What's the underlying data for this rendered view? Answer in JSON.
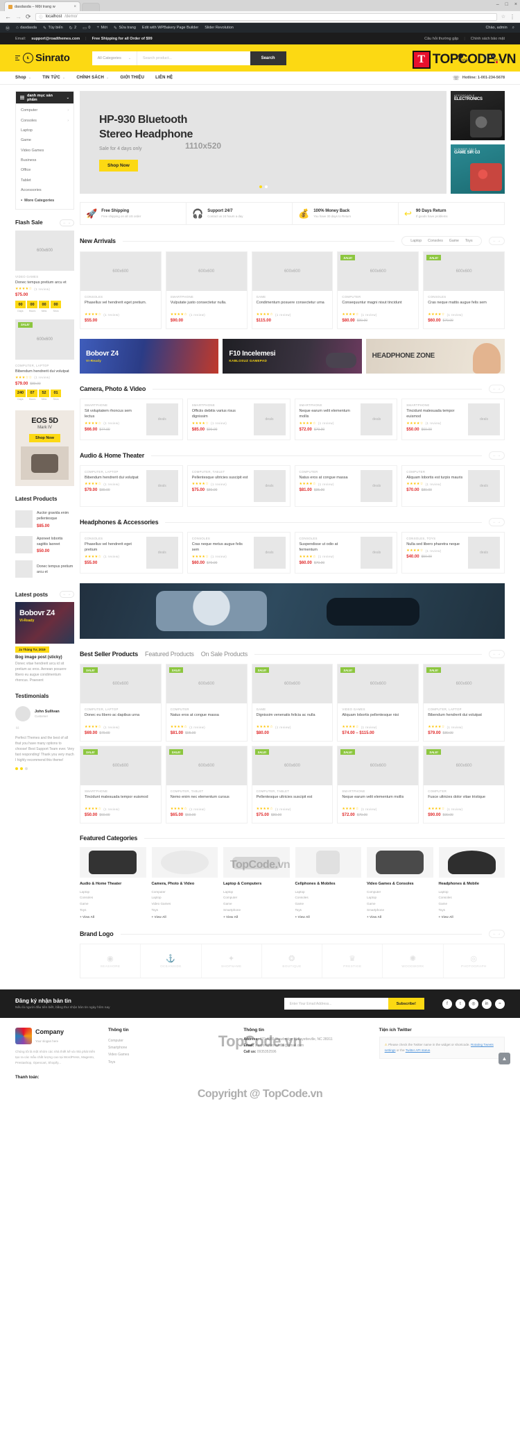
{
  "browser": {
    "tab_title": "dasdasda – Một trang w",
    "url_host": "localhost",
    "url_path": "/demo/",
    "lock_icon": "info-icon",
    "back_icon": "←",
    "forward_icon": "→",
    "reload_icon": "⟳",
    "star_icon": "☆",
    "menu_icon": "⋮",
    "minimize": "–",
    "maximize": "□",
    "close": "×"
  },
  "adminbar": {
    "wp_logo": "Ⓦ",
    "items": [
      {
        "icon": "home-icon",
        "label": "dasdasda"
      },
      {
        "icon": "pencil-icon",
        "label": "Tùy biến"
      },
      {
        "icon": "comment-icon",
        "label": "2"
      },
      {
        "icon": "speech-icon",
        "label": "0"
      },
      {
        "icon": "plus-icon",
        "label": "Mới"
      },
      {
        "icon": "edit-icon",
        "label": "Sửa trang"
      },
      {
        "icon": "",
        "label": "Edit with WPBakery Page Builder"
      },
      {
        "icon": "",
        "label": "Slider Revolution"
      }
    ],
    "right": [
      {
        "icon": "",
        "label": "Chào, admin"
      },
      {
        "icon": "search-icon",
        "label": ""
      }
    ]
  },
  "watermark": {
    "badge": "T",
    "text_a": "TOPCODE",
    "text_dot": ".",
    "text_b": "VN",
    "center_1": "TopCode.vn",
    "center_2": "TopCode.vn",
    "center_3": "Copyright @ TopCode.vn"
  },
  "topbar": {
    "email_label": "Email:",
    "email": "support@roadthemes.com",
    "shipping": "Free Shipping for all Order of $99",
    "link_faq": "Câu hỏi thường gặp",
    "link_privacy": "Chính sách bảo mật",
    "separator": "|"
  },
  "header": {
    "brand": "Sinrato",
    "search_category": "All Categories",
    "search_placeholder": "Search product...",
    "search_button": "Search",
    "wishlist_label": "Wishlist",
    "wishlist_count": "0",
    "cart_label": "My cart",
    "cart_count": "0",
    "heart_icon": "♡",
    "cart_icon": "🛒"
  },
  "mainnav": {
    "items": [
      {
        "label": "Shop",
        "caret": "⌄"
      },
      {
        "label": "TIN TỨC",
        "caret": "⌄"
      },
      {
        "label": "CHÍNH SÁCH",
        "caret": "⌄"
      },
      {
        "label": "GIỚI THIỆU",
        "caret": ""
      },
      {
        "label": "LIÊN HỆ",
        "caret": ""
      }
    ],
    "hotline": "Hotline: 1-001-234-5678",
    "hotline_icon": "headset-icon"
  },
  "sidebar": {
    "category_title": "danh mục sản phẩm",
    "categories": [
      {
        "label": "Computer",
        "arrow": "›"
      },
      {
        "label": "Consoles",
        "arrow": "›"
      },
      {
        "label": "Laptop",
        "arrow": ""
      },
      {
        "label": "Game",
        "arrow": ""
      },
      {
        "label": "Video Games",
        "arrow": ""
      },
      {
        "label": "Business",
        "arrow": ""
      },
      {
        "label": "Office",
        "arrow": ""
      },
      {
        "label": "Tablet",
        "arrow": ""
      },
      {
        "label": "Accessories",
        "arrow": ""
      }
    ],
    "more_categories": "More Categories",
    "flash_sale": {
      "title": "Flash Sale",
      "products": [
        {
          "placeholder": "600x600",
          "category": "VIDEO GAMES",
          "title": "Donec tempus pretium arcu et",
          "rating": "★★★★☆",
          "reviews": "(1 review)",
          "price": "$75.00",
          "old_price": "",
          "sale_badge": "",
          "countdown": [
            {
              "num": "00",
              "label": "Days"
            },
            {
              "num": "00",
              "label": "Hours"
            },
            {
              "num": "00",
              "label": "Mins"
            },
            {
              "num": "00",
              "label": "Secs"
            }
          ]
        },
        {
          "placeholder": "600x600",
          "category": "COMPUTER, LAPTOP",
          "title": "Bibendum hendrerit dui volutpat",
          "rating": "★★★☆☆",
          "reviews": "(1 review)",
          "price": "$79.00",
          "old_price": "$89.00",
          "sale_badge": "SALE!",
          "countdown": [
            {
              "num": "240",
              "label": "Days"
            },
            {
              "num": "07",
              "label": "Hours"
            },
            {
              "num": "52",
              "label": "Mins"
            },
            {
              "num": "01",
              "label": "Secs"
            }
          ]
        }
      ]
    },
    "promo": {
      "title": "EOS 5D",
      "subtitle": "Mark IV",
      "button": "Shop Now"
    },
    "latest_products": {
      "title": "Latest Products",
      "items": [
        {
          "thumb": "",
          "category": "",
          "title": "Auctor gravida enim pellentesque",
          "price": "$85.00"
        },
        {
          "thumb": "",
          "category": "",
          "title": "Aponeet lobortis sagittis laoreet",
          "price": "$50.00"
        },
        {
          "thumb": "",
          "category": "",
          "title": "Donec tempus pretium arcu et",
          "price": ""
        }
      ]
    },
    "latest_posts": {
      "title": "Latest posts",
      "post": {
        "overlay_title": "Bobovr Z4",
        "overlay_sub": "VI-Ready",
        "date": "Ja Tháng Tư, 2019",
        "title": "Bog image post (sticky)",
        "excerpt": "Donec vitae hendrerit arcu id sit pretium ac eros. Aenean posuere libero eu augue condimentum rhoncus. Praesent"
      }
    },
    "testimonials": {
      "title": "Testimonials",
      "name": "John Sullivan",
      "role": "Customer",
      "quote_mark": "❝",
      "body": "Perfect Themes and the best of all that you have many options to choose! Best Support Team ever. Very fast responding! Thank you very much I highly recommend this theme!",
      "dots": 3
    }
  },
  "hero": {
    "title_line1": "HP-930 Bluetooth",
    "title_line2": "Stereo Headphone",
    "subtitle": "Sale for 4 days only",
    "dimension": "1110x520",
    "button": "Shop Now",
    "dots": 2,
    "side_banners": [
      {
        "kicker": "AFFORDABLE",
        "title": "ELECTRONICS"
      },
      {
        "kicker": "SUMMER SALE",
        "title": "GAME SIR G3"
      }
    ]
  },
  "services": [
    {
      "icon": "rocket-icon",
      "title": "Free Shipping",
      "desc": "Free shipping on all US order"
    },
    {
      "icon": "headset-icon",
      "title": "Support 24/7",
      "desc": "Contact us 24 hours a day"
    },
    {
      "icon": "money-icon",
      "title": "100% Money Back",
      "desc": "You have 30 days to Return"
    },
    {
      "icon": "return-icon",
      "title": "90 Days Return",
      "desc": "If goods have problems"
    }
  ],
  "sections": {
    "new_arrivals": {
      "title": "New Arrivals",
      "tabs": [
        "Laptop",
        "Consoles",
        "Game",
        "Toys"
      ],
      "products": [
        {
          "placeholder": "600x600",
          "sale_badge": "",
          "category": "CONSOLES",
          "title": "Phasellus vel hendrerit eget pretium.",
          "rating": "★★★★☆",
          "reviews": "(1 review)",
          "price": "$55.00",
          "old_price": ""
        },
        {
          "placeholder": "600x600",
          "sale_badge": "",
          "category": "SMARTPHONE",
          "title": "Vulputate justo consectetur nulla.",
          "rating": "★★★★☆",
          "reviews": "(1 review)",
          "price": "$90.00",
          "old_price": ""
        },
        {
          "placeholder": "600x600",
          "sale_badge": "",
          "category": "GAME",
          "title": "Condimentum posuere consectetur urna",
          "rating": "★★★★☆",
          "reviews": "(1 review)",
          "price": "$115.00",
          "old_price": ""
        },
        {
          "placeholder": "600x600",
          "sale_badge": "SALE!",
          "category": "COMPUTER",
          "title": "Consequuntur magni nisut tincidunt",
          "rating": "★★★★☆",
          "reviews": "(1 review)",
          "price": "$80.00",
          "old_price": "$90.00"
        },
        {
          "placeholder": "600x600",
          "sale_badge": "SALE!",
          "category": "CONSOLES",
          "title": "Cras neque mattis augue felis sem",
          "rating": "★★★★☆",
          "reviews": "(1 review)",
          "price": "$60.00",
          "old_price": "$70.00"
        }
      ]
    },
    "mid_banners": [
      {
        "title": "Bobovr Z4",
        "sub": "VI-Ready"
      },
      {
        "title": "F10 Incelemesi",
        "sub": "KABLOSUZ GAMEPAD"
      },
      {
        "title": "HEADPHONE ZONE",
        "sub": ""
      }
    ],
    "camera_photo_video": {
      "title": "Camera, Photo & Video",
      "products": [
        {
          "category": "SMARTPHONE",
          "title": "Sit voluptatem rhoncus sem lectus",
          "rating": "★★★★☆",
          "reviews": "(1 review)",
          "price": "$66.00",
          "old_price": "$77.00",
          "thumb": "deals"
        },
        {
          "category": "SMARTPHONE",
          "title": "Officiis debitis varius risus dignissim",
          "rating": "★★★★☆",
          "reviews": "(1 review)",
          "price": "$85.00",
          "old_price": "$90.00",
          "thumb": "deals"
        },
        {
          "category": "SMARTPHONE",
          "title": "Neque earum velit elementum mollis",
          "rating": "★★★★☆",
          "reviews": "(1 review)",
          "price": "$72.00",
          "old_price": "$79.00",
          "thumb": "deals"
        },
        {
          "category": "SMARTPHONE",
          "title": "Tincidunt malesuada tempor euismod",
          "rating": "★★★★☆",
          "reviews": "(1 review)",
          "price": "$50.00",
          "old_price": "$60.00",
          "thumb": "deals"
        }
      ]
    },
    "audio_home_theater": {
      "title": "Audio & Home Theater",
      "products": [
        {
          "category": "COMPUTER, LAPTOP",
          "title": "Bibendum hendrerit dui volutpat",
          "rating": "★★★★☆",
          "reviews": "(1 review)",
          "price": "$79.00",
          "old_price": "$89.00",
          "thumb": "deals"
        },
        {
          "category": "COMPUTER, TABLET",
          "title": "Pellentesque ultricies suscipit est",
          "rating": "★★★★☆",
          "reviews": "(1 review)",
          "price": "$75.00",
          "old_price": "$80.00",
          "thumb": "deals"
        },
        {
          "category": "COMPUTER",
          "title": "Natus eros at congue massa",
          "rating": "★★★★☆",
          "reviews": "(1 review)",
          "price": "$81.00",
          "old_price": "$95.00",
          "thumb": "deals"
        },
        {
          "category": "COMPUTER",
          "title": "Aliquam lobortis est turpis mauris",
          "rating": "★★★★☆",
          "reviews": "(1 review)",
          "price": "$70.00",
          "old_price": "$80.00",
          "thumb": "deals"
        }
      ]
    },
    "headphones_accessories": {
      "title": "Headphones & Accessories",
      "products": [
        {
          "category": "CONSOLES",
          "title": "Phasellus vel hendrerit eget pretium",
          "rating": "★★★★☆",
          "reviews": "(1 review)",
          "price": "$55.00",
          "old_price": "",
          "thumb": "deals"
        },
        {
          "category": "CONSOLES",
          "title": "Cras neque metus augue felis sem",
          "rating": "★★★★☆",
          "reviews": "(1 review)",
          "price": "$60.00",
          "old_price": "$70.00",
          "thumb": "deals"
        },
        {
          "category": "CONSOLES",
          "title": "Suspendisse ut odio at fermentum",
          "rating": "★★★★☆",
          "reviews": "(1 review)",
          "price": "$60.00",
          "old_price": "$70.00",
          "thumb": "deals"
        },
        {
          "category": "CONSOLES, TOYS",
          "title": "Nulla sed libero pharetra neque",
          "rating": "★★★★☆",
          "reviews": "(1 review)",
          "price": "$40.00",
          "old_price": "$50.00",
          "thumb": "deals"
        }
      ]
    },
    "best_seller": {
      "tabs": [
        "Best Seller Products",
        "Featured Products",
        "On Sale Products"
      ],
      "active_tab": "Best Seller Products",
      "products": [
        {
          "placeholder": "600x600",
          "sale_badge": "SALE!",
          "category": "COMPUTER, LAPTOP",
          "title": "Donec eu libero ac dapibus urna",
          "rating": "★★★★☆",
          "reviews": "(1 review)",
          "price": "$69.00",
          "old_price": "$79.00"
        },
        {
          "placeholder": "600x600",
          "sale_badge": "SALE!",
          "category": "COMPUTER",
          "title": "Natus eros at congue massa",
          "rating": "★★★★☆",
          "reviews": "(1 review)",
          "price": "$81.00",
          "old_price": "$95.00"
        },
        {
          "placeholder": "600x600",
          "sale_badge": "SALE!",
          "category": "GAME",
          "title": "Dignissim venenatis felicia ac nulla",
          "rating": "★★★★☆",
          "reviews": "(1 review)",
          "price": "$80.00",
          "old_price": ""
        },
        {
          "placeholder": "600x600",
          "sale_badge": "SALE!",
          "category": "VIDEO GAMES",
          "title": "Aliquam lobortis pellentesque nisi",
          "rating": "★★★★☆",
          "reviews": "(1 review)",
          "price": "$74.00 – $115.00",
          "old_price": ""
        },
        {
          "placeholder": "600x600",
          "sale_badge": "SALE!",
          "category": "COMPUTER, LAPTOP",
          "title": "Bibendum hendrerit dui volutpat",
          "rating": "★★★★☆",
          "reviews": "(1 review)",
          "price": "$79.00",
          "old_price": "$89.00"
        },
        {
          "placeholder": "600x600",
          "sale_badge": "SALE!",
          "category": "SMARTPHONE",
          "title": "Tincidunt malesuada tempor euismod",
          "rating": "★★★★☆",
          "reviews": "(1 review)",
          "price": "$50.00",
          "old_price": "$60.00"
        },
        {
          "placeholder": "600x600",
          "sale_badge": "SALE!",
          "category": "COMPUTER, TABLET",
          "title": "Nemo enim nec elementum cursus",
          "rating": "★★★★☆",
          "reviews": "(1 review)",
          "price": "$65.00",
          "old_price": "$69.00"
        },
        {
          "placeholder": "600x600",
          "sale_badge": "SALE!",
          "category": "COMPUTER, TABLET",
          "title": "Pellentesque ultricies suscipit est",
          "rating": "★★★★☆",
          "reviews": "(1 review)",
          "price": "$75.00",
          "old_price": "$80.00"
        },
        {
          "placeholder": "600x600",
          "sale_badge": "SALE!",
          "category": "SMARTPHONE",
          "title": "Neque earum velit elementum mollis",
          "rating": "★★★★☆",
          "reviews": "(1 review)",
          "price": "$72.00",
          "old_price": "$79.00"
        },
        {
          "placeholder": "600x600",
          "sale_badge": "SALE!",
          "category": "COMPUTER",
          "title": "Fusce ultricies dolor vitae tristique",
          "rating": "★★★★☆",
          "reviews": "(1 review)",
          "price": "$90.00",
          "old_price": "$99.00"
        }
      ]
    },
    "featured_categories": {
      "title": "Featured Categories",
      "items": [
        {
          "name": "Audio & Home Theater",
          "sub": [
            "Laptop",
            "Consoles",
            "Game",
            "Toys"
          ],
          "viewall": "+ View All",
          "icon": "speakers-icon"
        },
        {
          "name": "Camera, Photo & Video",
          "sub": [
            "Computer",
            "Laptop",
            "Video Games",
            "Toys"
          ],
          "viewall": "+ View All",
          "icon": "camera-icon"
        },
        {
          "name": "Laptop & Computers",
          "sub": [
            "Laptop",
            "Computer",
            "Game",
            "Smartphone"
          ],
          "viewall": "+ View All",
          "icon": "laptop-icon"
        },
        {
          "name": "Cellphones & Mobiles",
          "sub": [
            "Laptop",
            "Consoles",
            "Game",
            "Toys"
          ],
          "viewall": "+ View All",
          "icon": "phone-icon"
        },
        {
          "name": "Video Games & Consoles",
          "sub": [
            "Computer",
            "Laptop",
            "Game",
            "Smartphone"
          ],
          "viewall": "+ View All",
          "icon": "gamepad-icon"
        },
        {
          "name": "Headphones & Mobile",
          "sub": [
            "Laptop",
            "Consoles",
            "Game",
            "Toys"
          ],
          "viewall": "+ View All",
          "icon": "headphone-icon"
        }
      ]
    },
    "brand_logo": {
      "title": "Brand Logo",
      "brands": [
        "SEASHORE",
        "OCEANSIDE",
        "SHOPNAME",
        "BOUTIQUE",
        "PRESTIGE",
        "WOODWORK",
        "PHOTOGRAPH"
      ]
    }
  },
  "newsletter": {
    "title": "Đăng ký nhận bản tin",
    "subtitle": "Nếu là người đầu tiên biết, bằng thư nhận bản tin ngày hôm nay",
    "placeholder": "Enter Your Email Address...",
    "button": "Subscribe!",
    "socials": [
      "f",
      "t",
      "◎",
      "in",
      "≈"
    ]
  },
  "footer": {
    "brand": "Company",
    "brand_tag": "Your slogan here",
    "description": "Chúng tôi là một nhóm các nhà thiết kế và nhà phát triển tạo ra các mẫu chất lượng cao tại WordPress, Magento, Prestashop, Opencart, Shopify...",
    "col2": {
      "title": "Thông tin",
      "items": [
        "Computer",
        "Smartphone",
        "Video Games",
        "Toys"
      ]
    },
    "col3": {
      "title": "Thông tin",
      "address_label": "Address:",
      "address": "470-4889 Stawbridge St,Fayetteville, NC 28311",
      "email_label": "Email:",
      "email": "support@tronghl99@gmail.com",
      "phone_label": "Call us:",
      "phone": "0935352596"
    },
    "col4": {
      "title": "Tiện ích Twitter",
      "warning": "Please check the Twitter name in the widget or shortcode.",
      "link1": "Rotating Tweets settings",
      "mid": "or the",
      "link2": "Twitter API status",
      "tail": "."
    },
    "payment_label": "Thanh toán:",
    "totop_icon": "▲"
  }
}
